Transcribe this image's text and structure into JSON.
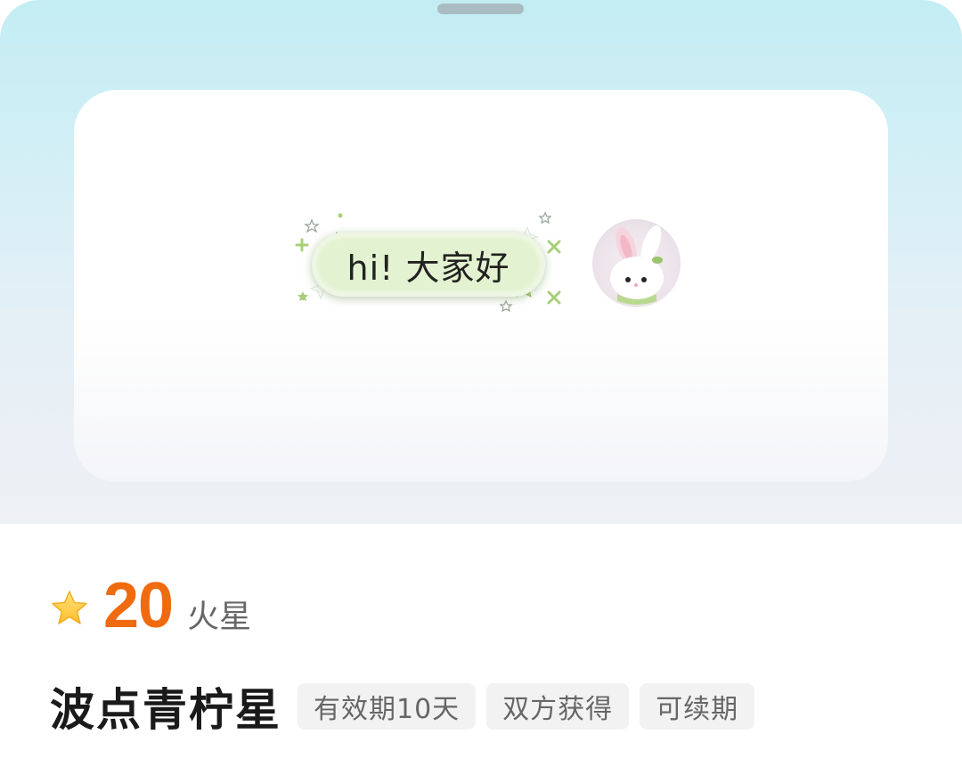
{
  "preview": {
    "bubble_text": "hi! 大家好"
  },
  "item": {
    "price": "20",
    "currency_unit": "火星",
    "name": "波点青柠星",
    "tags": [
      {
        "label": "有效期10天"
      },
      {
        "label": "双方获得"
      },
      {
        "label": "可续期"
      }
    ]
  },
  "icons": {
    "price_icon": "star-icon",
    "avatar": "bunny-avatar-icon"
  },
  "colors": {
    "accent_orange": "#f06a0f",
    "bubble_green": "#e3f2d0",
    "deco_green": "#a8cf78",
    "header_cyan": "#c3edf3"
  }
}
